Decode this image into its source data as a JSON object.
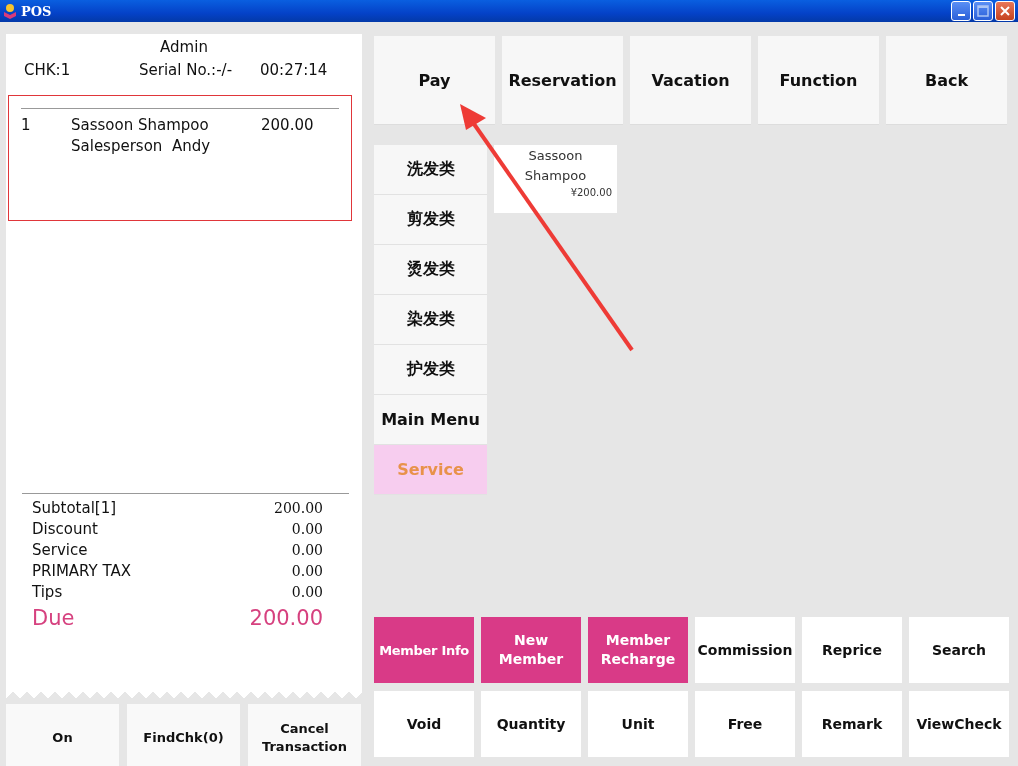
{
  "window": {
    "title": "POS"
  },
  "receipt": {
    "operator": "Admin",
    "check": "CHK:1",
    "serial": "Serial No.:-/-",
    "time": "00:27:14",
    "items": [
      {
        "index": "1",
        "name": "Sassoon Shampoo",
        "price": "200.00",
        "salesperson": "Salesperson  Andy"
      }
    ],
    "totals": [
      {
        "label": "Subtotal[1]",
        "value": "200.00"
      },
      {
        "label": "Discount",
        "value": "0.00"
      },
      {
        "label": "Service",
        "value": "0.00"
      },
      {
        "label": "PRIMARY TAX",
        "value": "0.00"
      },
      {
        "label": "Tips",
        "value": "0.00"
      }
    ],
    "due": {
      "label": "Due",
      "value": "200.00"
    }
  },
  "receipt_buttons": [
    "On",
    "FindChk(0)",
    "Cancel Transaction"
  ],
  "top_buttons": [
    "Pay",
    "Reservation",
    "Vacation",
    "Function",
    "Back"
  ],
  "categories": [
    {
      "label": "洗发类",
      "selected": false
    },
    {
      "label": "剪发类",
      "selected": false
    },
    {
      "label": "烫发类",
      "selected": false
    },
    {
      "label": "染发类",
      "selected": false
    },
    {
      "label": "护发类",
      "selected": false
    },
    {
      "label": "Main Menu",
      "selected": false
    },
    {
      "label": "Service",
      "selected": true
    }
  ],
  "products": [
    {
      "name": "Sassoon Shampoo",
      "price": "¥200.00"
    }
  ],
  "actions": [
    {
      "label": "Member Info",
      "highlighted": true
    },
    {
      "label": "New Member",
      "highlighted": true
    },
    {
      "label": "Member Recharge",
      "highlighted": true
    },
    {
      "label": "Commission",
      "highlighted": false
    },
    {
      "label": "Reprice",
      "highlighted": false
    },
    {
      "label": "Search",
      "highlighted": false
    },
    {
      "label": "Void",
      "highlighted": false
    },
    {
      "label": "Quantity",
      "highlighted": false
    },
    {
      "label": "Unit",
      "highlighted": false
    },
    {
      "label": "Free",
      "highlighted": false
    },
    {
      "label": "Remark",
      "highlighted": false
    },
    {
      "label": "ViewCheck",
      "highlighted": false
    }
  ]
}
